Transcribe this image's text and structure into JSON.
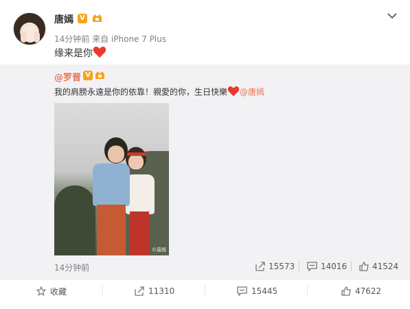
{
  "post": {
    "author": "唐嫣",
    "time": "14分钟前",
    "source": "来自 iPhone 7 Plus",
    "text": "缘来是你"
  },
  "repost": {
    "author": "@罗晋",
    "text": "我的肩膀永遠是你的依靠！親愛的你，生日快樂",
    "mention": "@唐嫣",
    "time": "14分钟前",
    "reposts": "15573",
    "comments": "14016",
    "likes": "41524",
    "watermark": "©唐嫣"
  },
  "actions": {
    "favorite": "收藏",
    "reposts": "11310",
    "comments": "15445",
    "likes": "47622"
  },
  "colors": {
    "accent": "#eb7350",
    "badge": "#f7a21b",
    "heart": "#e8392f"
  }
}
